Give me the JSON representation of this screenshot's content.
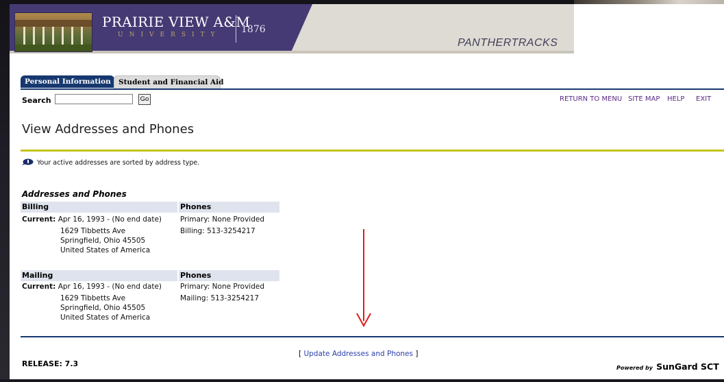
{
  "header": {
    "university_name": "PRAIRIE VIEW A&M",
    "university_sub": "UNIVERSITY",
    "founded_year": "1876",
    "app_name": "PANTHERTRACKS"
  },
  "tabs": [
    {
      "label": "Personal Information",
      "active": true
    },
    {
      "label": "Student and Financial Aid",
      "active": false
    }
  ],
  "search": {
    "label": "Search",
    "value": "",
    "go_label": "Go"
  },
  "top_links": [
    "RETURN TO MENU",
    "SITE MAP",
    "HELP",
    "EXIT"
  ],
  "page_title": "View Addresses and Phones",
  "info_message": "Your active addresses are sorted by address type.",
  "section_title": "Addresses and Phones",
  "addresses": [
    {
      "type": "Billing",
      "phones_header": "Phones",
      "current_label": "Current:",
      "current_range": "Apr 16, 1993 - (No end date)",
      "street": "1629 Tibbetts Ave",
      "city_line": "Springfield, Ohio   45505",
      "country": "United States of America",
      "phone_primary": "Primary: None Provided",
      "phone_other": "Billing: 513-3254217"
    },
    {
      "type": "Mailing",
      "phones_header": "Phones",
      "current_label": "Current:",
      "current_range": "Apr 16, 1993 - (No end date)",
      "street": "1629 Tibbetts Ave",
      "city_line": "Springfield, Ohio   45505",
      "country": "United States of America",
      "phone_primary": "Primary: None Provided",
      "phone_other": "Mailing: 513-3254217"
    }
  ],
  "footer": {
    "update_link": "Update Addresses and Phones",
    "bracket_open": "[",
    "bracket_close": "]",
    "release": "RELEASE: 7.3",
    "powered_prefix": "Powered by",
    "powered_brand": "SunGard SCT"
  },
  "colors": {
    "banner_purple": "#453a74",
    "tab_navy": "#16386f",
    "title_rule": "#c5c41a",
    "link_purple": "#5b2a86",
    "annotation_red": "#e01a1a"
  },
  "icons": {
    "info": "info-speech-bubble-icon",
    "arrow": "red-down-arrow"
  }
}
